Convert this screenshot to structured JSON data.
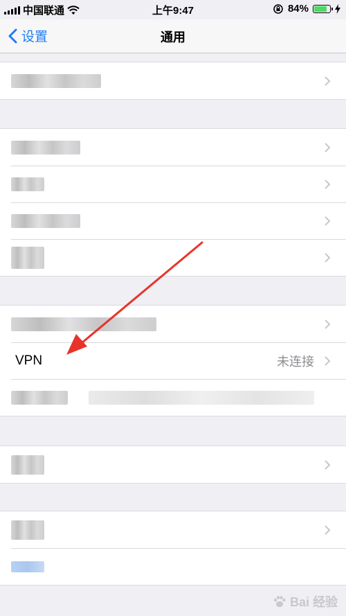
{
  "status_bar": {
    "carrier": "中国联通",
    "time": "上午9:47",
    "battery_percent": "84%",
    "battery_level": 0.84
  },
  "nav": {
    "back_label": "设置",
    "title": "通用"
  },
  "vpn": {
    "label": "VPN",
    "status": "未连接"
  },
  "watermark": {
    "text": "Bai 经验"
  },
  "colors": {
    "accent": "#1e7cf2",
    "annotation_arrow": "#e8332a",
    "background": "#efeff4"
  }
}
